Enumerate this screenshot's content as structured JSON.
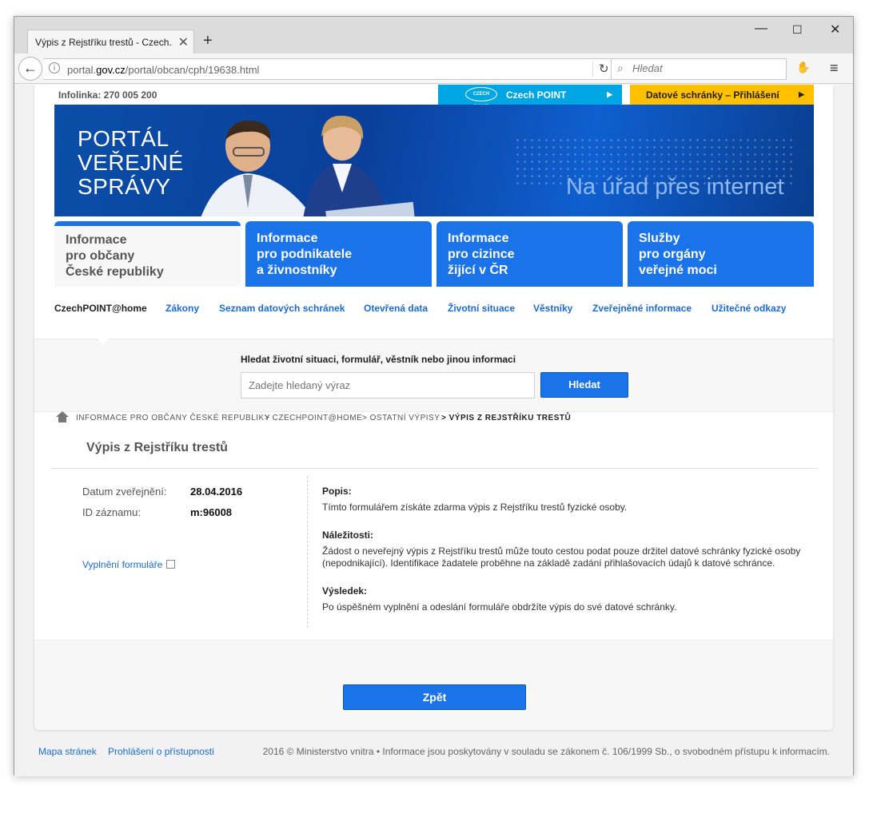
{
  "browser": {
    "tab_title": "Výpis z Rejstříku trestů - Czech...",
    "url_prefix": "portal.",
    "url_domain": "gov.cz",
    "url_path": "/portal/obcan/cph/19638.html",
    "search_placeholder": "Hledat"
  },
  "topbar": {
    "infolinka": "Infolinka: 270 005 200",
    "czech_point_logo": "CZECH POINT",
    "czech_point": "Czech POINT",
    "datove": "Datové schránky – Přihlášení"
  },
  "banner": {
    "title_lines": [
      "PORTÁL",
      "VEŘEJNÉ",
      "SPRÁVY"
    ],
    "slogan": "Na úřad přes internet"
  },
  "tabs": [
    {
      "lines": [
        "Informace",
        "pro občany",
        "České republiky"
      ]
    },
    {
      "lines": [
        "Informace",
        "pro podnikatele",
        "a živnostníky"
      ]
    },
    {
      "lines": [
        "Informace",
        "pro cizince",
        "žijící v ČR"
      ]
    },
    {
      "lines": [
        "Služby",
        "pro orgány",
        "veřejné moci"
      ]
    }
  ],
  "subnav": [
    "CzechPOINT@home",
    "Zákony",
    "Seznam datových schránek",
    "Otevřená data",
    "Životní situace",
    "Věstníky",
    "Zveřejněné informace",
    "Užitečné odkazy"
  ],
  "search": {
    "label": "Hledat životní situaci, formulář, věstník nebo jinou informaci",
    "placeholder": "Zadejte hledaný výraz",
    "button": "Hledat"
  },
  "breadcrumb": [
    "Informace pro občany České republiky",
    "> CzechPOINT@home",
    "> Ostatní výpisy",
    "> Výpis z Rejstříku trestů"
  ],
  "page_title": "Výpis z Rejstříku trestů",
  "meta": {
    "date_label": "Datum zveřejnění:",
    "date_value": "28.04.2016",
    "id_label": "ID záznamu:",
    "id_value": "m:96008",
    "form_link": "Vyplnění formuláře"
  },
  "description": {
    "popis_head": "Popis:",
    "popis_text": "Tímto formulářem získáte zdarma výpis z Rejstříku trestů fyzické osoby.",
    "nalezitosti_head": "Náležitosti:",
    "nalezitosti_text": "Žádost o neveřejný výpis z Rejstříku trestů může touto cestou podat pouze držitel datové schránky fyzické osoby (nepodnikající). Identifikace žadatele proběhne na základě zadání přihlašovacích údajů k datové schránce.",
    "vysledek_head": "Výsledek:",
    "vysledek_text": "Po úspěšném vyplnění a odeslání formuláře obdržíte výpis do své datové schránky."
  },
  "back_button": "Zpět",
  "footer": {
    "sitemap": "Mapa stránek",
    "accessibility": "Prohlášení o přístupnosti",
    "copyright": "2016 © Ministerstvo vnitra • Informace jsou poskytovány v souladu se zákonem č. 106/1999 Sb., o svobodném přístupu k informacím."
  },
  "colors": {
    "accent_blue": "#1a73e8",
    "czech_point": "#00a5e4",
    "datove_yellow": "#ffc000"
  }
}
